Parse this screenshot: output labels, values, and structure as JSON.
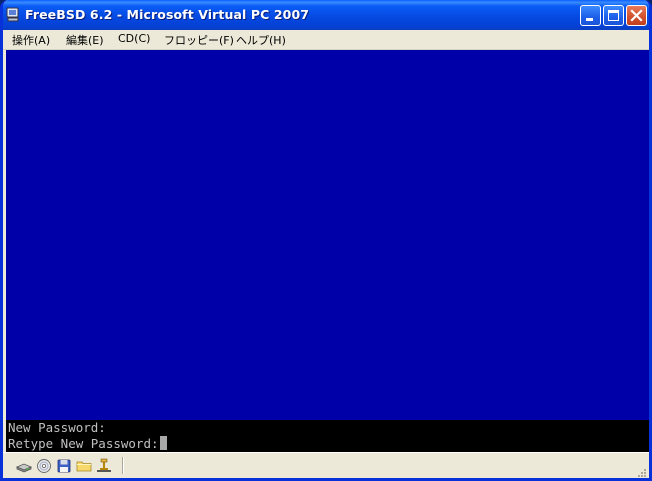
{
  "window": {
    "title": "FreeBSD 6.2 - Microsoft Virtual PC 2007"
  },
  "menu": [
    {
      "label": "操作(A)"
    },
    {
      "label": "編集(E)"
    },
    {
      "label": "CD(C)"
    },
    {
      "label": "フロッピー(F)"
    },
    {
      "label": "ヘルプ(H)"
    }
  ],
  "console": {
    "lines": [
      "New Password:",
      "Retype New Password:"
    ]
  },
  "colors": {
    "screen_background": "#0000a8",
    "console_background": "#000000",
    "console_text": "#c0c0c0",
    "titlebar": "#0548e0"
  },
  "statusbar": {
    "icons": [
      "hard-disk-icon",
      "cd-drive-icon",
      "floppy-disk-icon",
      "shared-folder-icon",
      "network-icon"
    ]
  }
}
